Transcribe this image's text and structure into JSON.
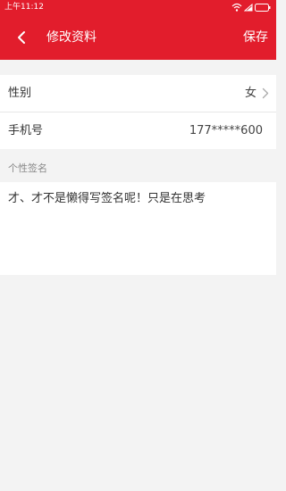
{
  "status_bar": {
    "time": "上午11:12"
  },
  "header": {
    "title": "修改资料",
    "save_label": "保存"
  },
  "form": {
    "gender": {
      "label": "性别",
      "value": "女"
    },
    "phone": {
      "label": "手机号",
      "value": "177*****600"
    }
  },
  "signature": {
    "section_label": "个性签名",
    "value": "才、才不是懒得写签名呢！只是在思考"
  },
  "icons": {
    "back": "chevron-left-icon",
    "row_arrow": "chevron-right-icon",
    "wifi": "wifi-icon",
    "signal": "signal-icon",
    "battery": "battery-icon"
  },
  "colors": {
    "brand_red": "#e21d2c",
    "background": "#f3f3f3",
    "card": "#ffffff"
  }
}
